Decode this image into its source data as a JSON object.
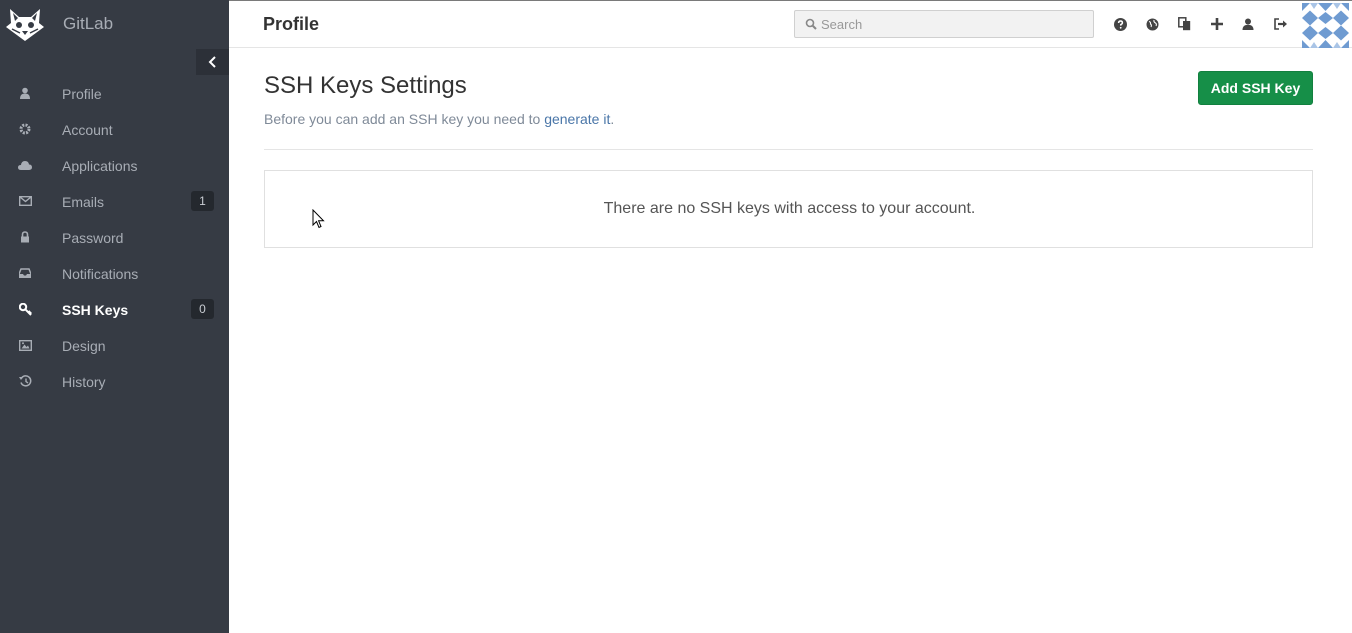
{
  "app": {
    "name": "GitLab"
  },
  "sidebar": {
    "items": [
      {
        "label": "Profile",
        "icon": "user-icon",
        "active": false,
        "badge": null
      },
      {
        "label": "Account",
        "icon": "gear-icon",
        "active": false,
        "badge": null
      },
      {
        "label": "Applications",
        "icon": "cloud-icon",
        "active": false,
        "badge": null
      },
      {
        "label": "Emails",
        "icon": "envelope-icon",
        "active": false,
        "badge": "1"
      },
      {
        "label": "Password",
        "icon": "lock-icon",
        "active": false,
        "badge": null
      },
      {
        "label": "Notifications",
        "icon": "inbox-icon",
        "active": false,
        "badge": null
      },
      {
        "label": "SSH Keys",
        "icon": "key-icon",
        "active": true,
        "badge": "0"
      },
      {
        "label": "Design",
        "icon": "image-icon",
        "active": false,
        "badge": null
      },
      {
        "label": "History",
        "icon": "history-icon",
        "active": false,
        "badge": null
      }
    ]
  },
  "header": {
    "title": "Profile",
    "search_placeholder": "Search",
    "search_value": "",
    "icons": [
      "help-icon",
      "globe-icon",
      "copy-icon",
      "plus-icon",
      "user-icon",
      "sign-out-icon"
    ]
  },
  "main": {
    "title": "SSH Keys Settings",
    "description_before": "Before you can add an SSH key you need to ",
    "description_link": "generate it",
    "description_after": ".",
    "add_button_label": "Add SSH Key",
    "empty_message": "There are no SSH keys with access to your account."
  },
  "colors": {
    "sidebar_bg": "#363b44",
    "sidebar_text": "#a8adb5",
    "active_text": "#ffffff",
    "badge_bg": "#24282e",
    "primary_button": "#168f48",
    "link": "#4a76a8",
    "avatar_primary": "#6f9bd1"
  }
}
